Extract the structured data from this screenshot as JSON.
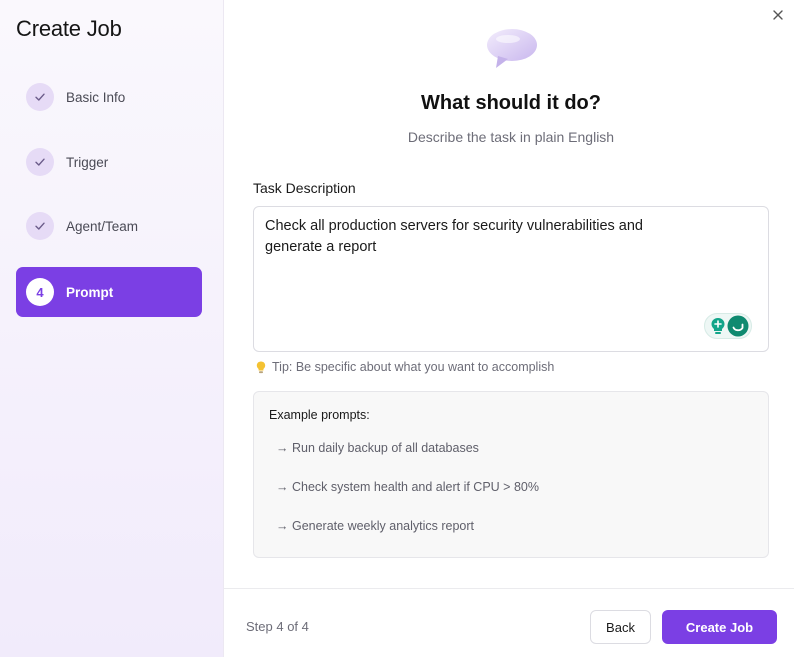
{
  "sidebar": {
    "title": "Create Job",
    "steps": [
      {
        "label": "Basic Info",
        "state": "complete"
      },
      {
        "label": "Trigger",
        "state": "complete"
      },
      {
        "label": "Agent/Team",
        "state": "complete"
      },
      {
        "label": "Prompt",
        "number": "4",
        "state": "active"
      }
    ]
  },
  "main": {
    "icon": "speech-bubble-icon",
    "heading": "What should it do?",
    "subheading": "Describe the task in plain English",
    "task_label": "Task Description",
    "task_value": "Check all production servers for security vulnerabilities and\ngenerate a report",
    "tip": "Tip: Be specific about what you want to accomplish",
    "examples_title": "Example prompts:",
    "examples": [
      "→ Run daily backup of all databases",
      "→ Check system health and alert if CPU > 80%",
      "→ Generate weekly analytics report"
    ]
  },
  "footer": {
    "step_text": "Step 4 of 4",
    "back_label": "Back",
    "create_label": "Create Job"
  },
  "colors": {
    "accent": "#7b3fe4",
    "sidebar_bg": "#f5f1fb",
    "check_circle": "#e6dbf6"
  }
}
